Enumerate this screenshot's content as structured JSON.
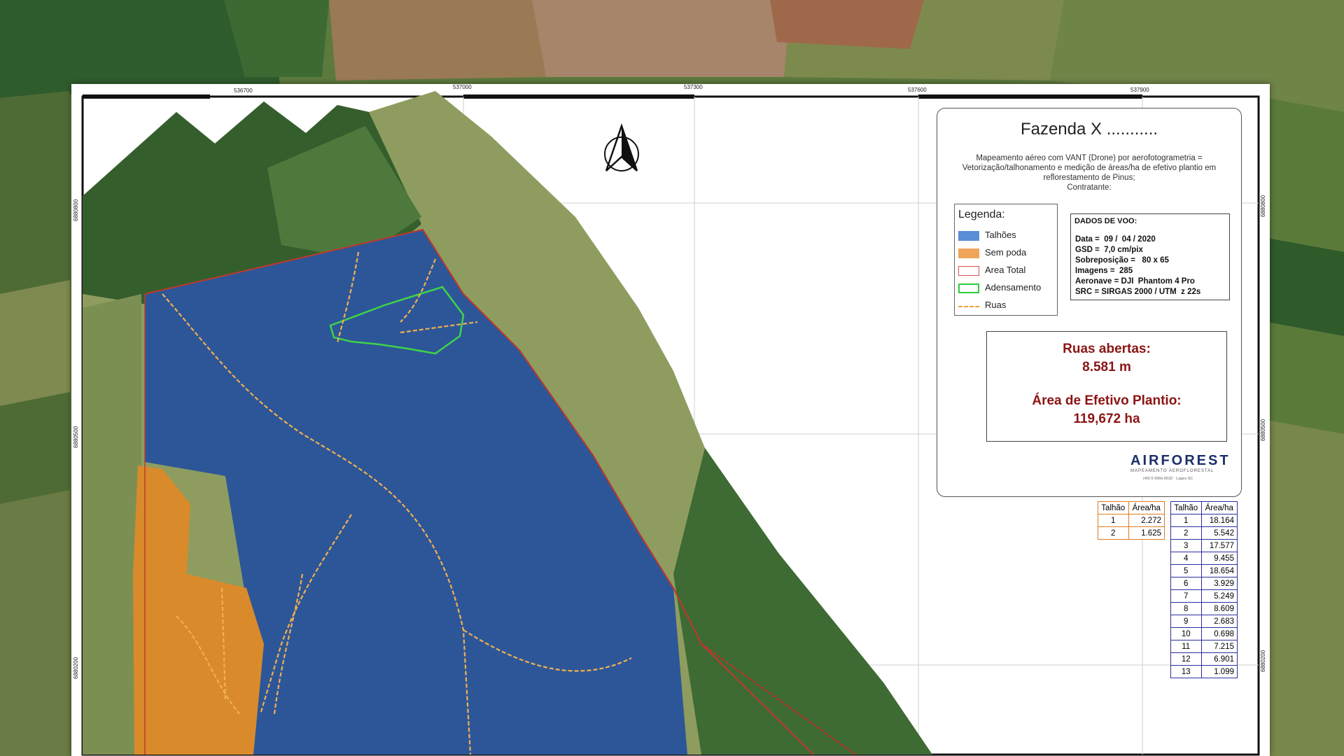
{
  "map": {
    "title": "Fazenda X ...........",
    "description": "Mapeamento aéreo com VANT (Drone) por aerofotogrametria = Vetorização/talhonamento e medição de áreas/ha de efetivo plantio em reflorestamento de Pinus;",
    "contractor": "Contratante:",
    "north_arrow": "north-arrow-icon",
    "top_ticks": [
      "536700",
      "537000",
      "537300",
      "537600",
      "537900"
    ],
    "left_ticks": [
      "6880800",
      "6880500",
      "6880200"
    ],
    "right_ticks": [
      "6880800",
      "6880500",
      "6880200"
    ]
  },
  "legend": {
    "title": "Legenda:",
    "items": [
      {
        "label": "Talhões",
        "color": "#5b8ed6",
        "style": "fill"
      },
      {
        "label": "Sem poda",
        "color": "#f0a45a",
        "style": "fill"
      },
      {
        "label": "Area Total",
        "color": "#d9534f",
        "style": "outline"
      },
      {
        "label": "Adensamento",
        "color": "#2ecc40",
        "style": "outline"
      },
      {
        "label": "Ruas",
        "color": "#e8a33a",
        "style": "dashed"
      }
    ]
  },
  "flight": {
    "title": "DADOS DE VOO:",
    "lines": [
      "Data =  09 /  04 / 2020",
      "GSD =  7,0 cm/pix",
      "Sobreposição =   80 x 65",
      "Imagens =  285",
      "Aeronave = DJI  Phantom 4 Pro",
      "SRC = SIRGAS 2000 / UTM  z 22s"
    ]
  },
  "stats": {
    "roads_label": "Ruas abertas:",
    "roads_value": "8.581 m",
    "area_label": "Área de Efetivo Plantio:",
    "area_value": "119,672  ha"
  },
  "logo": {
    "main": "AIRFOREST",
    "sub": "MAPEAMENTO AEROFLORESTAL",
    "contact": "(49) 9 9956-6532 · Lages SC"
  },
  "table_unpruned": {
    "headers": [
      "Talhão",
      "Área/ha"
    ],
    "rows": [
      [
        "1",
        "2.272"
      ],
      [
        "2",
        "1.625"
      ]
    ]
  },
  "table_plots": {
    "headers": [
      "Talhão",
      "Área/ha"
    ],
    "rows": [
      [
        "1",
        "18.164"
      ],
      [
        "2",
        "5.542"
      ],
      [
        "3",
        "17.577"
      ],
      [
        "4",
        "9.455"
      ],
      [
        "5",
        "18.654"
      ],
      [
        "6",
        "3.929"
      ],
      [
        "7",
        "5.249"
      ],
      [
        "8",
        "8.609"
      ],
      [
        "9",
        "2.683"
      ],
      [
        "10",
        "0.698"
      ],
      [
        "11",
        "7.215"
      ],
      [
        "12",
        "6.901"
      ],
      [
        "13",
        "1.099"
      ]
    ]
  },
  "colors": {
    "plot_fill": "#2f5a9e",
    "unpruned_fill": "#d98a2b",
    "forest_dark": "#2f5a2a",
    "pasture": "#8a9c5e",
    "boundary": "#c0392b",
    "densification": "#3fd24a",
    "road": "#f0b050"
  }
}
